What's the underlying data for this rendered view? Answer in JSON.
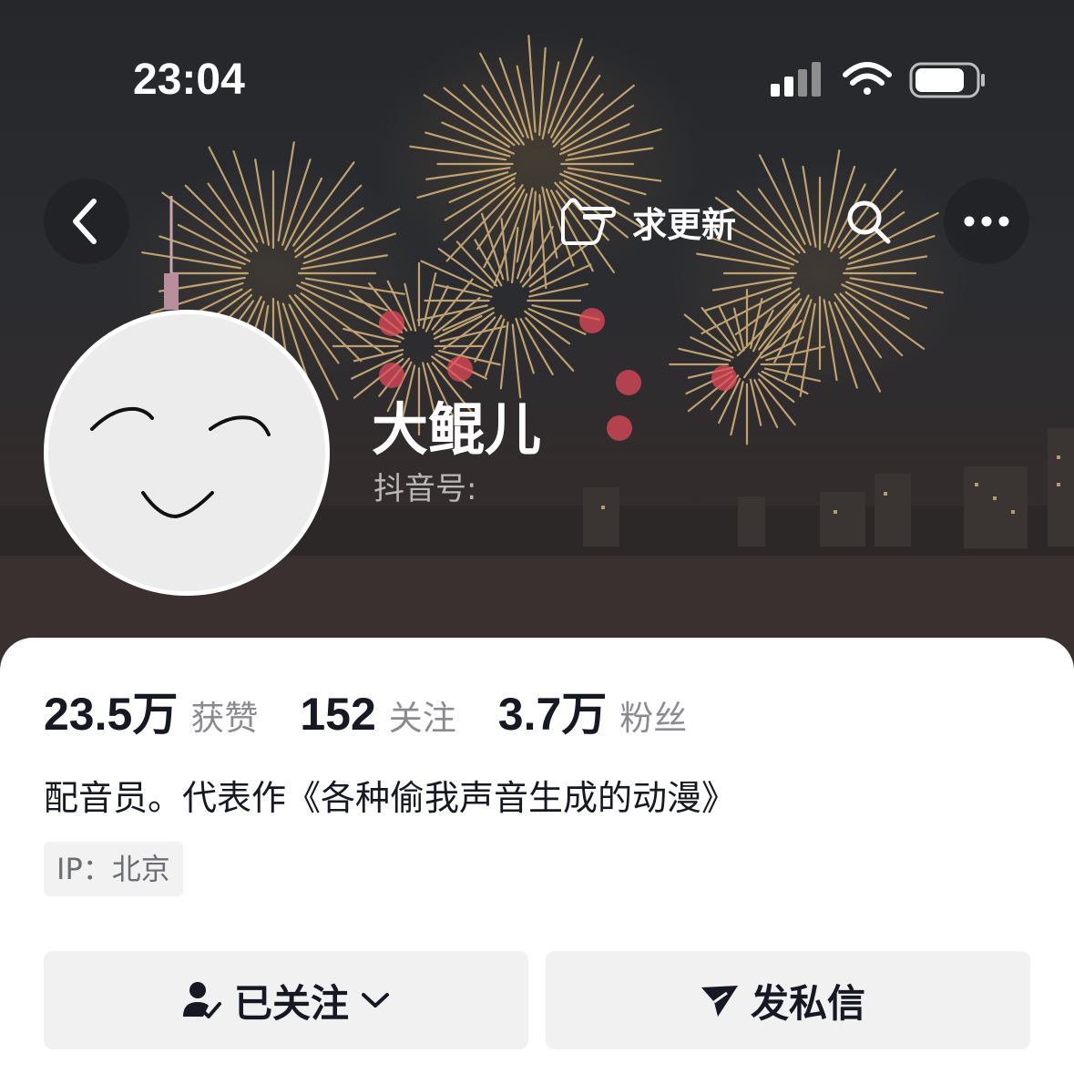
{
  "status_bar": {
    "time": "23:04"
  },
  "header": {
    "update_label": "求更新"
  },
  "profile": {
    "name": "大鲲儿",
    "douyin_id_label": "抖音号:",
    "stats": [
      {
        "value": "23.5万",
        "label": "获赞"
      },
      {
        "value": "152",
        "label": "关注"
      },
      {
        "value": "3.7万",
        "label": "粉丝"
      }
    ],
    "bio": "配音员。代表作《各种偷我声音生成的动漫》",
    "ip_location": "IP：北京"
  },
  "actions": {
    "follow_label": "已关注",
    "message_label": "发私信"
  },
  "icons": [
    "back-icon",
    "hand-pointer-icon",
    "search-icon",
    "more-icon",
    "signal-icon",
    "wifi-icon",
    "battery-icon",
    "user-check-icon",
    "chevron-down-icon",
    "send-icon"
  ],
  "colors": {
    "text_primary": "#161823",
    "text_secondary": "#8a8b91",
    "button_bg": "#f1f1f2",
    "banner_bg": "#2a2c30"
  }
}
